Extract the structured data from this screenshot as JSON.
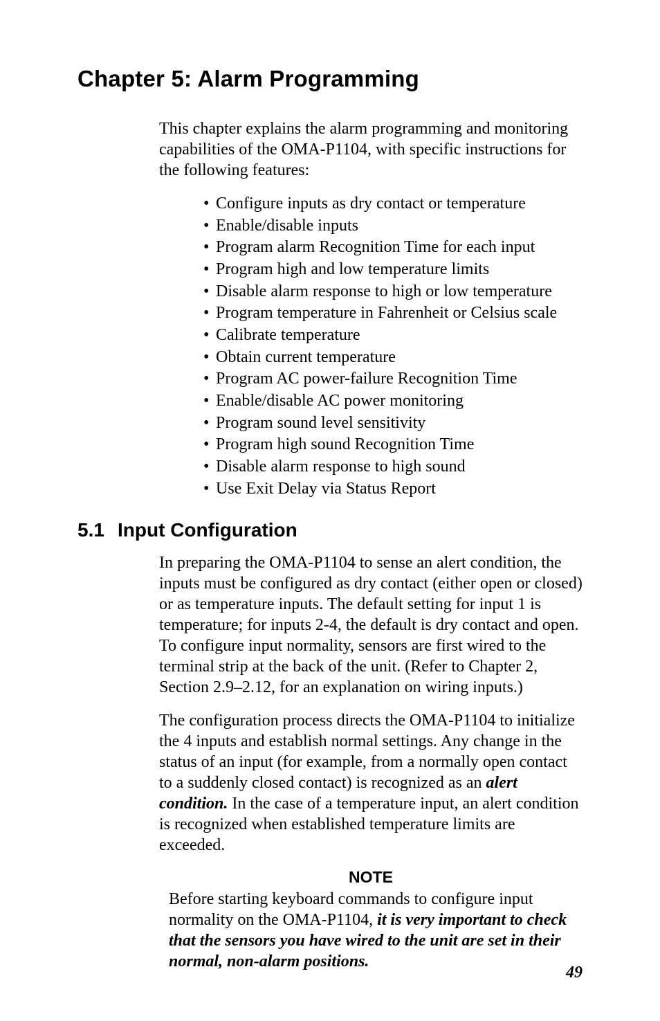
{
  "chapter": {
    "title": "Chapter 5: Alarm Programming",
    "intro": "This chapter explains the alarm programming and monitoring capabilities of the OMA-P1104, with specific instructions for the following features:",
    "bullets": [
      "Configure inputs as dry contact or temperature",
      "Enable/disable inputs",
      "Program alarm Recognition Time for each input",
      "Program high and low temperature limits",
      "Disable alarm response to high or low temperature",
      "Program temperature in Fahrenheit or Celsius scale",
      "Calibrate temperature",
      "Obtain current temperature",
      "Program AC power-failure Recognition Time",
      "Enable/disable AC power monitoring",
      "Program sound level sensitivity",
      "Program high sound Recognition Time",
      "Disable alarm response to high sound",
      "Use Exit Delay via Status Report"
    ]
  },
  "section": {
    "number": "5.1",
    "title": "Input Configuration",
    "para1": "In preparing the OMA-P1104 to sense an alert condition, the inputs must be configured as dry contact (either open or closed) or as temperature inputs. The default setting for input 1 is temperature; for inputs 2-4, the default is dry contact and open.  To configure input normality, sensors are first wired to the terminal strip at the back of the unit. (Refer to Chapter 2, Section 2.9–2.12, for an explanation on wiring inputs.)",
    "para2_pre": "The configuration process directs the OMA-P1104 to initialize the 4 inputs and establish normal settings. Any change in the status of an input (for example, from a normally open contact to a suddenly closed contact) is recognized as an ",
    "para2_em": "alert condition.",
    "para2_post": " In the case of a temperature input, an alert condition is recognized when established temperature limits are exceeded."
  },
  "note": {
    "heading": "NOTE",
    "body_pre": "Before starting keyboard commands to configure input normality on the OMA-P1104, ",
    "body_em": "it is very important to check that the sensors you have wired to the unit are set in their normal, non-alarm positions."
  },
  "page_number": "49"
}
